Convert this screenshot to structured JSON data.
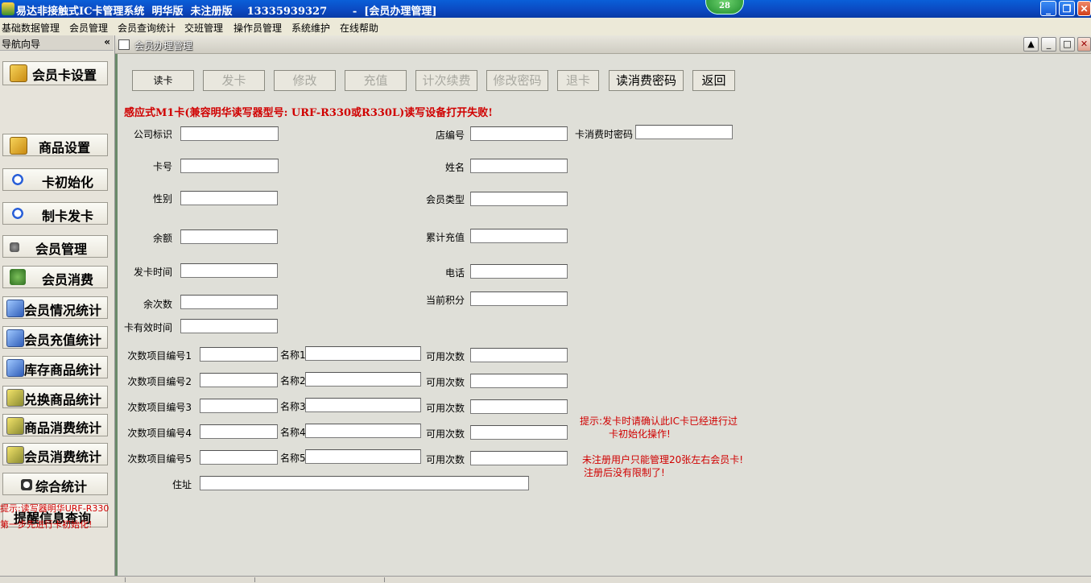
{
  "window": {
    "title": "易达非接触式IC卡管理系统  明华版  未注册版    13335939327       -  [会员办理管理]",
    "badge": "28",
    "buttons": {
      "minimize": "_",
      "restore": "❐",
      "close": "✕"
    }
  },
  "menu": [
    "基础数据管理",
    "会员管理",
    "会员查询统计",
    "交班管理",
    "操作员管理",
    "系统维护",
    "在线帮助"
  ],
  "nav": {
    "title": "导航向导",
    "collapse": "«",
    "items": [
      {
        "label": "会员卡设置",
        "icon": "card-gear-icon"
      },
      {
        "label": "商品设置",
        "icon": "card-goods-icon"
      },
      {
        "label": "卡初始化",
        "icon": "arrows-init-icon"
      },
      {
        "label": "制卡发卡",
        "icon": "arrows-issue-icon"
      },
      {
        "label": "会员管理",
        "icon": "person-icon"
      },
      {
        "label": "会员消费",
        "icon": "money-bag-icon"
      },
      {
        "label": "会员情况统计",
        "icon": "stats-icon"
      },
      {
        "label": "会员充值统计",
        "icon": "stats-icon"
      },
      {
        "label": "库存商品统计",
        "icon": "stats-icon"
      },
      {
        "label": "兑换商品统计",
        "icon": "bolt-icon"
      },
      {
        "label": "商品消费统计",
        "icon": "bolt-icon"
      },
      {
        "label": "会员消费统计",
        "icon": "bolt-icon"
      },
      {
        "label": "综合统计",
        "icon": "magnifier-icon"
      },
      {
        "label": "提醒信息查询",
        "icon": ""
      }
    ],
    "hint_line1": "提示:读写器明华URF-R330",
    "hint_line2": "第一步先进行卡初始化!"
  },
  "mdi": {
    "title": "会员办理管理",
    "buttons": {
      "up": "▲",
      "minimize": "_",
      "maximize": "□",
      "close": "✕"
    }
  },
  "toolbar": [
    {
      "label": "读卡",
      "enabled": true
    },
    {
      "label": "发卡",
      "enabled": false
    },
    {
      "label": "修改",
      "enabled": false
    },
    {
      "label": "充值",
      "enabled": false
    },
    {
      "label": "计次续费",
      "enabled": false
    },
    {
      "label": "修改密码",
      "enabled": false
    },
    {
      "label": "退卡",
      "enabled": false
    },
    {
      "label": "读消费密码",
      "enabled": true
    },
    {
      "label": "返回",
      "enabled": true
    }
  ],
  "status_message": "感应式M1卡(兼容明华读写器型号: URF-R330或R330L)读写设备打开失败!",
  "form": {
    "company_id": {
      "label": "公司标识",
      "value": ""
    },
    "store_no": {
      "label": "店编号",
      "value": ""
    },
    "consume_password": {
      "label": "卡消费时密码",
      "value": ""
    },
    "card_no": {
      "label": "卡号",
      "value": ""
    },
    "name": {
      "label": "姓名",
      "value": ""
    },
    "gender": {
      "label": "性别",
      "value": ""
    },
    "member_type": {
      "label": "会员类型",
      "value": ""
    },
    "balance": {
      "label": "余额",
      "value": ""
    },
    "total_recharge": {
      "label": "累计充值",
      "value": ""
    },
    "issue_time": {
      "label": "发卡时间",
      "value": ""
    },
    "phone": {
      "label": "电话",
      "value": ""
    },
    "remaining_times": {
      "label": "余次数",
      "value": ""
    },
    "current_points": {
      "label": "当前积分",
      "value": ""
    },
    "valid_time": {
      "label": "卡有效时间",
      "value": ""
    },
    "address": {
      "label": "住址",
      "value": ""
    }
  },
  "count_items": [
    {
      "code_label": "次数项目编号1",
      "name_label": "名称1",
      "avail_label": "可用次数"
    },
    {
      "code_label": "次数项目编号2",
      "name_label": "名称2",
      "avail_label": "可用次数"
    },
    {
      "code_label": "次数项目编号3",
      "name_label": "名称3",
      "avail_label": "可用次数"
    },
    {
      "code_label": "次数项目编号4",
      "name_label": "名称4",
      "avail_label": "可用次数"
    },
    {
      "code_label": "次数项目编号5",
      "name_label": "名称5",
      "avail_label": "可用次数"
    }
  ],
  "tips": {
    "tip1_line1": "提示:发卡时请确认此IC卡已经进行过",
    "tip1_line2": "卡初始化操作!",
    "tip2_line1": "未注册用户只能管理20张左右会员卡!",
    "tip2_line2": "注册后没有限制了!"
  },
  "colors": {
    "titlebar": "#0b48c0",
    "alert_red": "#d00000",
    "nav_bg": "#e6e3da"
  }
}
